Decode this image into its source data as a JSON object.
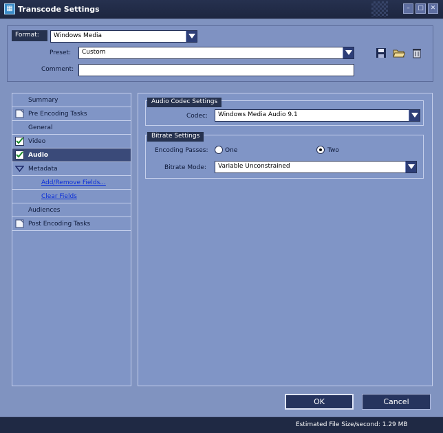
{
  "window": {
    "title": "Transcode Settings"
  },
  "top": {
    "format_label": "Format:",
    "format_value": "Windows Media",
    "preset_label": "Preset:",
    "preset_value": "Custom",
    "comment_label": "Comment:",
    "comment_value": ""
  },
  "sidebar": {
    "items": [
      {
        "label": "Summary"
      },
      {
        "label": "Pre Encoding Tasks"
      },
      {
        "label": "General"
      },
      {
        "label": "Video"
      },
      {
        "label": "Audio"
      },
      {
        "label": "Metadata"
      },
      {
        "label": "Add/Remove Fields..."
      },
      {
        "label": "Clear Fields"
      },
      {
        "label": "Audiences"
      },
      {
        "label": "Post Encoding Tasks"
      }
    ]
  },
  "audio_codec": {
    "title": "Audio Codec Settings",
    "codec_label": "Codec:",
    "codec_value": "Windows Media Audio 9.1"
  },
  "bitrate": {
    "title": "Bitrate Settings",
    "passes_label": "Encoding Passes:",
    "option_one": "One",
    "option_two": "Two",
    "selected_pass": "Two",
    "mode_label": "Bitrate Mode:",
    "mode_value": "Variable Unconstrained"
  },
  "buttons": {
    "ok": "OK",
    "cancel": "Cancel"
  },
  "status": {
    "text": "Estimated File Size/second: 1.29 MB"
  },
  "colors": {
    "background": "#8093c0",
    "title_bar": "#1f2944",
    "active_item": "#3a4a79",
    "link": "#0a2ed8"
  }
}
